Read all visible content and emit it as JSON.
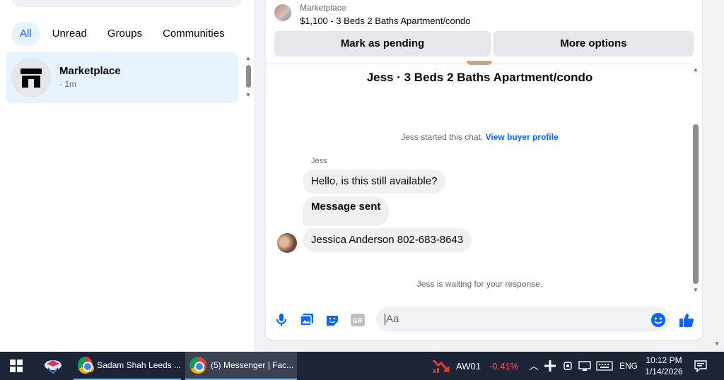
{
  "sidebar": {
    "filters": [
      "All",
      "Unread",
      "Groups",
      "Communities"
    ],
    "active_filter": "All",
    "conversations": [
      {
        "name": "Marketplace",
        "time": "· 1m"
      }
    ]
  },
  "chat": {
    "header": {
      "category": "Marketplace",
      "listing_title": "$1,100 - 3 Beds 2 Baths Apartment/condo"
    },
    "actions": {
      "mark_pending": "Mark as pending",
      "more_options": "More options"
    },
    "listing_heading": "Jess · 3 Beds 2 Baths Apartment/condo",
    "system_started": "Jess started this chat.",
    "view_buyer_profile": "View buyer profile",
    "sender_name": "Jess",
    "messages": [
      "Hello, is this still available?",
      "Message sent",
      "Jessica Anderson 802-683-8643"
    ],
    "system_waiting": "Jess is waiting for your response.",
    "composer": {
      "placeholder": "Aa",
      "icons": [
        "microphone-icon",
        "photo-icon",
        "sticker-icon",
        "gif-icon",
        "emoji-icon",
        "like-icon"
      ]
    }
  },
  "taskbar": {
    "apps": [
      {
        "label": "Sadam Shah Leeds ...",
        "badge": "C"
      },
      {
        "label": "(5) Messenger | Fac...",
        "active": true
      }
    ],
    "stock": {
      "symbol": "AW01",
      "change": "-0.41%",
      "change_color": "#ff5a5a"
    },
    "language": "ENG",
    "time": "10:12 PM",
    "date": "1/14/2026"
  },
  "colors": {
    "accent": "#0866ff",
    "selected_bg": "#e7f3ff",
    "bubble": "#f0f0f0"
  }
}
